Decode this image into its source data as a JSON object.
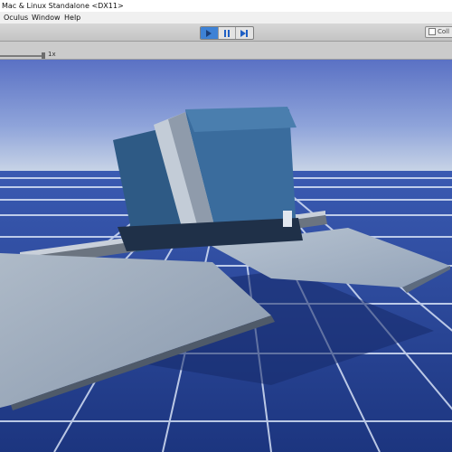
{
  "window": {
    "title": "Mac & Linux Standalone <DX11>"
  },
  "menu": {
    "items": [
      "Oculus",
      "Window",
      "Help"
    ]
  },
  "toolbar": {
    "collab_label": "Coll"
  },
  "game_view": {
    "scale_label": "1x"
  },
  "icons": {
    "play": "play-icon",
    "pause": "pause-icon",
    "step": "step-icon"
  },
  "colors": {
    "accent": "#3e82d6",
    "sky_top": "#5a71c4",
    "horizon": "#c7d3e6",
    "grid_tile": "#213f9a"
  }
}
